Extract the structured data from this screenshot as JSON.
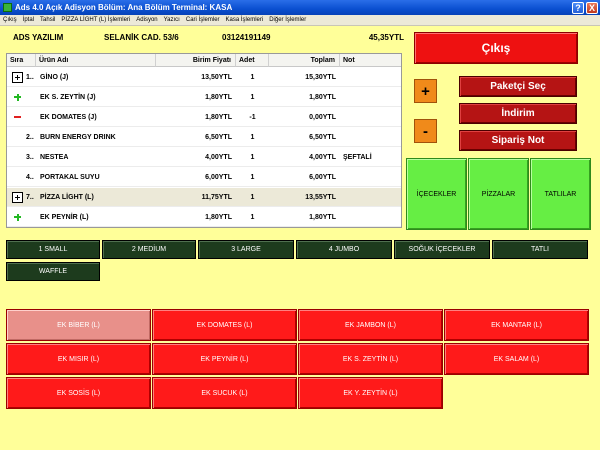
{
  "window": {
    "title": "Ads 4.0 Açık Adisyon Bölüm: Ana Bölüm Terminal: KASA",
    "help_label": "?",
    "close_label": "X"
  },
  "menu": [
    "Çıkış",
    "İptal",
    "Tahsil",
    "PİZZA LİGHT (L) İşlemleri",
    "Adisyon",
    "Yazıcı",
    "Cari İşlemler",
    "Kasa İşlemleri",
    "Diğer İşlemler"
  ],
  "header": {
    "company": "ADS YAZILIM",
    "address": "SELANİK CAD. 53/6",
    "phone": "03124191149",
    "total": "45,35YTL"
  },
  "table": {
    "columns": [
      "Sıra",
      "Ürün Adı",
      "Birim Fiyatı",
      "Adet",
      "Toplam",
      "Not"
    ],
    "rows": [
      {
        "marker": "box",
        "sira": "1..",
        "name": "GİNO (J)",
        "price": "13,50YTL",
        "qty": "1",
        "total": "15,30YTL",
        "note": ""
      },
      {
        "marker": "plus",
        "sira": "",
        "name": "EK S. ZEYTİN (J)",
        "price": "1,80YTL",
        "qty": "1",
        "total": "1,80YTL",
        "note": ""
      },
      {
        "marker": "minus",
        "sira": "",
        "name": "EK DOMATES (J)",
        "price": "1,80YTL",
        "qty": "-1",
        "total": "0,00YTL",
        "note": ""
      },
      {
        "marker": "",
        "sira": "2..",
        "name": "BURN ENERGY DRINK",
        "price": "6,50YTL",
        "qty": "1",
        "total": "6,50YTL",
        "note": ""
      },
      {
        "marker": "",
        "sira": "3..",
        "name": "NESTEA",
        "price": "4,00YTL",
        "qty": "1",
        "total": "4,00YTL",
        "note": "ŞEFTALİ"
      },
      {
        "marker": "",
        "sira": "4..",
        "name": "PORTAKAL SUYU",
        "price": "6,00YTL",
        "qty": "1",
        "total": "6,00YTL",
        "note": ""
      },
      {
        "marker": "box",
        "sira": "7..",
        "name": "PİZZA LİGHT (L)",
        "price": "11,75YTL",
        "qty": "1",
        "total": "13,55YTL",
        "note": ""
      },
      {
        "marker": "plus",
        "sira": "",
        "name": "EK PEYNİR (L)",
        "price": "1,80YTL",
        "qty": "1",
        "total": "1,80YTL",
        "note": ""
      }
    ]
  },
  "actions": {
    "exit": "Çıkış",
    "plus": "+",
    "minus": "-",
    "packet": "Paketçi Seç",
    "discount": "İndirim",
    "order_note": "Sipariş Not"
  },
  "groups": [
    "İÇECEKLER",
    "PİZZALAR",
    "TATLILAR"
  ],
  "categories": [
    "1 SMALL",
    "2 MEDİUM",
    "3 LARGE",
    "4 JUMBO",
    "SOĞUK İÇECEKLER",
    "TATLI",
    "WAFFLE"
  ],
  "items": [
    "EK BİBER (L)",
    "EK DOMATES (L)",
    "EK JAMBON (L)",
    "EK MANTAR (L)",
    "EK MISIR (L)",
    "EK PEYNİR (L)",
    "EK S. ZEYTİN (L)",
    "EK SALAM (L)",
    "EK SOSİS (L)",
    "EK SUCUK (L)",
    "EK Y. ZEYTİN (L)"
  ],
  "colors": {
    "background": "#ffff99",
    "title_bar": "#0a4fd0",
    "red_button": "#ee1111",
    "green_button": "#66ee44",
    "category_button": "#1d3b1d",
    "orange_button": "#f08a1a"
  }
}
